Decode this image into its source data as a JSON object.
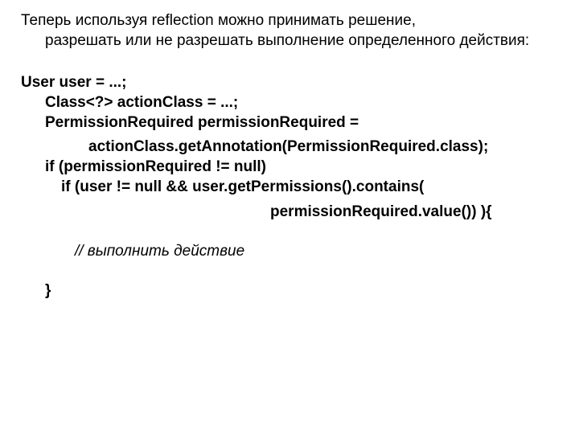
{
  "intro": {
    "first": "Теперь используя reflection можно принимать решение,",
    "rest": "разрешать или не разрешать выполнение определенного действия:"
  },
  "code": {
    "l1": "User user = ...;",
    "l2": "Class<?> actionClass = ...;",
    "l3": "PermissionRequired permissionRequired =",
    "l4": "actionClass.getAnnotation(PermissionRequired.class);",
    "l5": "if (permissionRequired != null)",
    "l6": "if (user != null && user.getPermissions().contains(",
    "l7": "permissionRequired.value()) ){",
    "l8": "// выполнить действие",
    "l9": "}"
  }
}
